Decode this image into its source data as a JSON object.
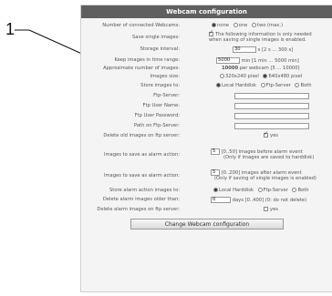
{
  "callout": {
    "number": "1"
  },
  "panel": {
    "title": "Webcam configuration"
  },
  "rows": {
    "connected": {
      "label": "Number of connected Webcams:",
      "options": [
        "none",
        "one",
        "two (max.)"
      ]
    },
    "save_single": {
      "label": "Save single images:",
      "text1": "The following information is only needed",
      "text2": "when saving of single images is enabled."
    },
    "storage": {
      "label": "Storage interval:",
      "value": "30",
      "hint": "s [2 s ... 300 s]"
    },
    "keep_range": {
      "label": "Keep images in time range:",
      "value": "5000",
      "hint": "min [1 min ... 5000 min]"
    },
    "approx": {
      "label": "Approximate number of images:",
      "value": "10000",
      "hint": "per webcam [5 ... 10000]"
    },
    "size": {
      "label": "Images size:",
      "options": [
        "320x240 pixel",
        "640x480 pixel"
      ]
    },
    "store_to": {
      "label": "Store images to:",
      "options": [
        "Local Harddisk",
        "Ftp-Server",
        "Both"
      ]
    },
    "ftp_server": {
      "label": "Ftp-Server:"
    },
    "ftp_user": {
      "label": "Ftp User Name:"
    },
    "ftp_pass": {
      "label": "Ftp User Password:"
    },
    "ftp_path": {
      "label": "Path on Ftp-Server:"
    },
    "delete_old": {
      "label": "Delete old images on ftp server:",
      "option": "yes"
    },
    "alarm_before": {
      "label": "Images to save as alarm action:",
      "value": "5",
      "hint1": "[0..50] images before alarm event",
      "hint2": "(Only if images are saved to harddisk)"
    },
    "alarm_after": {
      "label": "Images to save as alarm action:",
      "value": "5",
      "hint1": "[0..200] images after alarm event",
      "hint2": "(Only if saving of single images is enabled)"
    },
    "alarm_store": {
      "label": "Store alarm action images to:",
      "options": [
        "Local Harddisk",
        "Ftp-Server",
        "Both"
      ]
    },
    "alarm_delete": {
      "label": "Delete alarm images older than:",
      "value": "0",
      "hint": "days [0..400] (0: do not delete)"
    },
    "alarm_ftp_delete": {
      "label": "Delete alarm images on ftp server:",
      "option": "yes"
    }
  },
  "button": {
    "label": "Change Webcam configuration"
  }
}
